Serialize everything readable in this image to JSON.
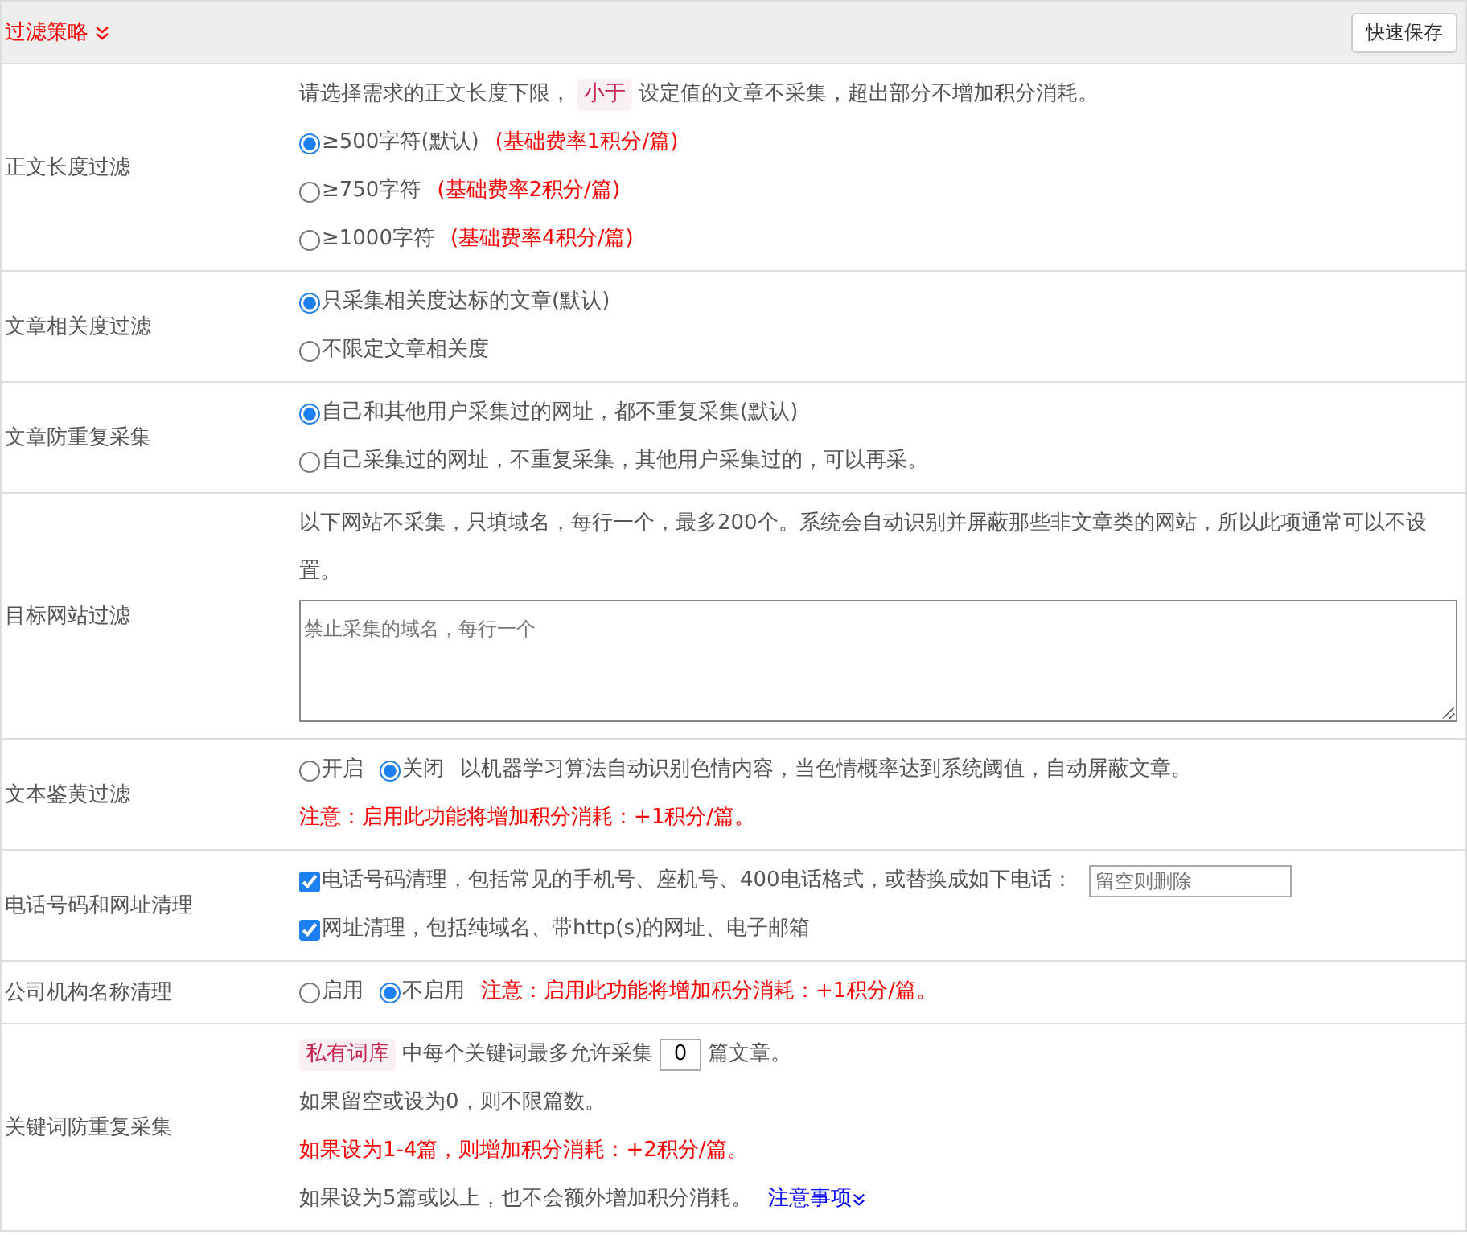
{
  "header": {
    "title": "过滤策略",
    "save_button": "快速保存"
  },
  "rows": [
    {
      "label": "正文长度过滤",
      "lines": [
        {
          "parts": [
            {
              "kind": "text",
              "text": "请选择需求的正文长度下限，"
            },
            {
              "kind": "tag",
              "text": "小于"
            },
            {
              "kind": "text",
              "text": "设定值的文章不采集，超出部分不增加积分消耗。"
            }
          ]
        },
        {
          "parts": [
            {
              "kind": "radio",
              "label": "≥500字符(默认)",
              "selected": true
            },
            {
              "kind": "warn",
              "text": "(基础费率1积分/篇)"
            }
          ]
        },
        {
          "parts": [
            {
              "kind": "radio",
              "label": "≥750字符",
              "selected": false
            },
            {
              "kind": "warn",
              "text": "(基础费率2积分/篇)"
            }
          ]
        },
        {
          "parts": [
            {
              "kind": "radio",
              "label": "≥1000字符",
              "selected": false
            },
            {
              "kind": "warn",
              "text": "(基础费率4积分/篇)"
            }
          ]
        }
      ]
    },
    {
      "label": "文章相关度过滤",
      "lines": [
        {
          "parts": [
            {
              "kind": "radio",
              "label": "只采集相关度达标的文章(默认)",
              "selected": true
            }
          ]
        },
        {
          "parts": [
            {
              "kind": "radio",
              "label": "不限定文章相关度",
              "selected": false
            }
          ]
        }
      ]
    },
    {
      "label": "文章防重复采集",
      "lines": [
        {
          "parts": [
            {
              "kind": "radio",
              "label": "自己和其他用户采集过的网址，都不重复采集(默认)",
              "selected": true
            }
          ]
        },
        {
          "parts": [
            {
              "kind": "radio",
              "label": "自己采集过的网址，不重复采集，其他用户采集过的，可以再采。",
              "selected": false
            }
          ]
        }
      ]
    },
    {
      "label": "目标网站过滤",
      "lines": [
        {
          "parts": [
            {
              "kind": "text",
              "text": "以下网站不采集，只填域名，每行一个，最多200个。系统会自动识别并屏蔽那些非文章类的网站，所以此项通常可以不设置。"
            }
          ]
        },
        {
          "parts": [
            {
              "kind": "textarea",
              "placeholder": "禁止采集的域名，每行一个"
            }
          ]
        }
      ]
    },
    {
      "label": "文本鉴黄过滤",
      "lines": [
        {
          "parts": [
            {
              "kind": "radio",
              "label": "开启",
              "selected": false
            },
            {
              "kind": "radio",
              "label": "关闭",
              "selected": true
            },
            {
              "kind": "text",
              "text": "以机器学习算法自动识别色情内容，当色情概率达到系统阈值，自动屏蔽文章。"
            }
          ]
        },
        {
          "parts": [
            {
              "kind": "warn",
              "text": "注意：启用此功能将增加积分消耗：+1积分/篇。"
            }
          ]
        }
      ]
    },
    {
      "label": "电话号码和网址清理",
      "lines": [
        {
          "parts": [
            {
              "kind": "checkbox",
              "label": "电话号码清理，包括常见的手机号、座机号、400电话格式，或替换成如下电话：",
              "checked": true
            },
            {
              "kind": "input",
              "placeholder": "留空则删除"
            }
          ]
        },
        {
          "parts": [
            {
              "kind": "checkbox",
              "label": "网址清理，包括纯域名、带http(s)的网址、电子邮箱",
              "checked": true
            }
          ]
        }
      ]
    },
    {
      "label": "公司机构名称清理",
      "lines": [
        {
          "parts": [
            {
              "kind": "radio",
              "label": "启用",
              "selected": false
            },
            {
              "kind": "radio",
              "label": "不启用",
              "selected": true
            },
            {
              "kind": "warn",
              "text": "注意：启用此功能将增加积分消耗：+1积分/篇。"
            }
          ]
        }
      ]
    },
    {
      "label": "关键词防重复采集",
      "lines": [
        {
          "parts": [
            {
              "kind": "tag",
              "text": "私有词库"
            },
            {
              "kind": "text",
              "text": "中每个关键词最多允许采集"
            },
            {
              "kind": "number",
              "value": "0"
            },
            {
              "kind": "text",
              "text": "篇文章。"
            }
          ]
        },
        {
          "parts": [
            {
              "kind": "text",
              "text": "如果留空或设为0，则不限篇数。"
            }
          ]
        },
        {
          "parts": [
            {
              "kind": "warn",
              "text": "如果设为1-4篇，则增加积分消耗：+2积分/篇。"
            }
          ]
        },
        {
          "parts": [
            {
              "kind": "text",
              "text": "如果设为5篇或以上，也不会额外增加积分消耗。"
            },
            {
              "kind": "link",
              "text": "注意事项"
            }
          ]
        }
      ]
    }
  ]
}
